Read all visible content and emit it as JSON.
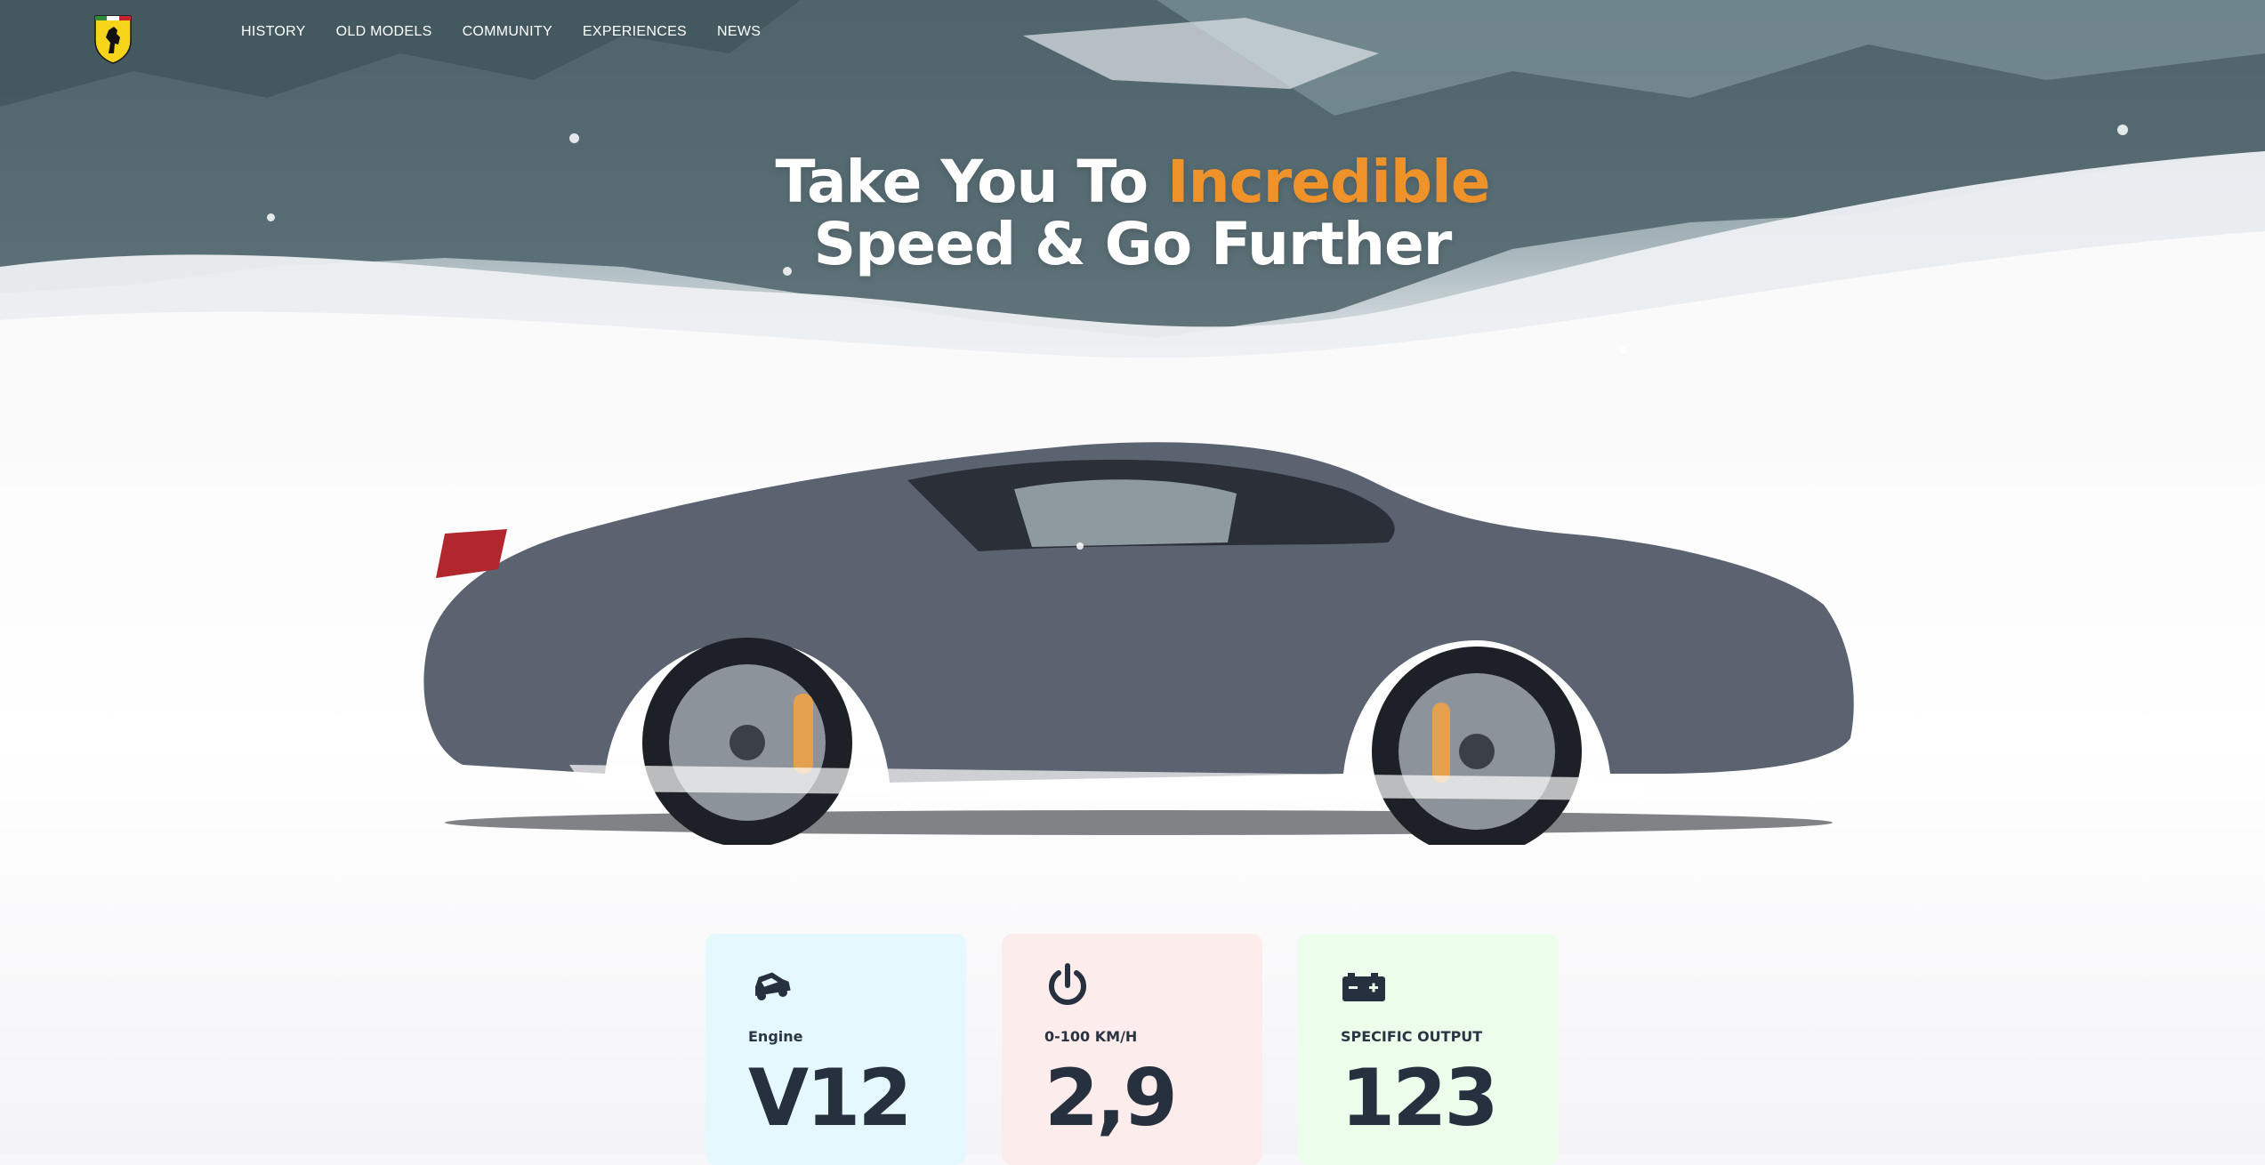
{
  "brand": {
    "logo_icon": "prancing-horse-shield-icon",
    "accent_color": "#f0922a",
    "shield_color": "#f5d41a"
  },
  "nav": {
    "items": [
      {
        "label": "HISTORY"
      },
      {
        "label": "OLD MODELS"
      },
      {
        "label": "COMMUNITY"
      },
      {
        "label": "EXPERIENCES"
      },
      {
        "label": "NEWS"
      }
    ]
  },
  "hero": {
    "line1_prefix": "Take You To",
    "line1_accent": "Incredible",
    "line2": "Speed & Go Further"
  },
  "cards": [
    {
      "icon": "car-icon",
      "label": "Engine",
      "value": "V12",
      "bg": "#e4f8fd"
    },
    {
      "icon": "power-icon",
      "label": "0-100 KM/H",
      "value": "2,9",
      "bg": "#fdecec"
    },
    {
      "icon": "battery-icon",
      "label": "SPECIFIC OUTPUT",
      "value": "123",
      "bg": "#ecfdec"
    }
  ]
}
